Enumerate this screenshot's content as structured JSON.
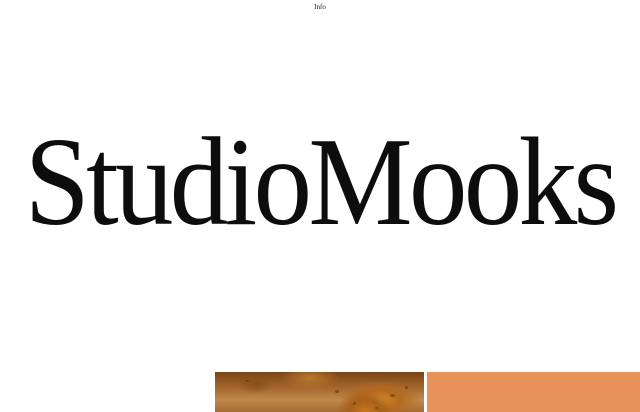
{
  "nav": {
    "info_label": "Info"
  },
  "hero": {
    "title": "StudioMooks"
  },
  "gallery": {
    "tiles": [
      {
        "kind": "photo",
        "subject": "rock-texture"
      },
      {
        "kind": "color-block",
        "color": "#e8925a"
      }
    ]
  },
  "colors": {
    "background": "#ffffff",
    "text": "#0d0d0d",
    "accent_orange": "#e8925a"
  }
}
